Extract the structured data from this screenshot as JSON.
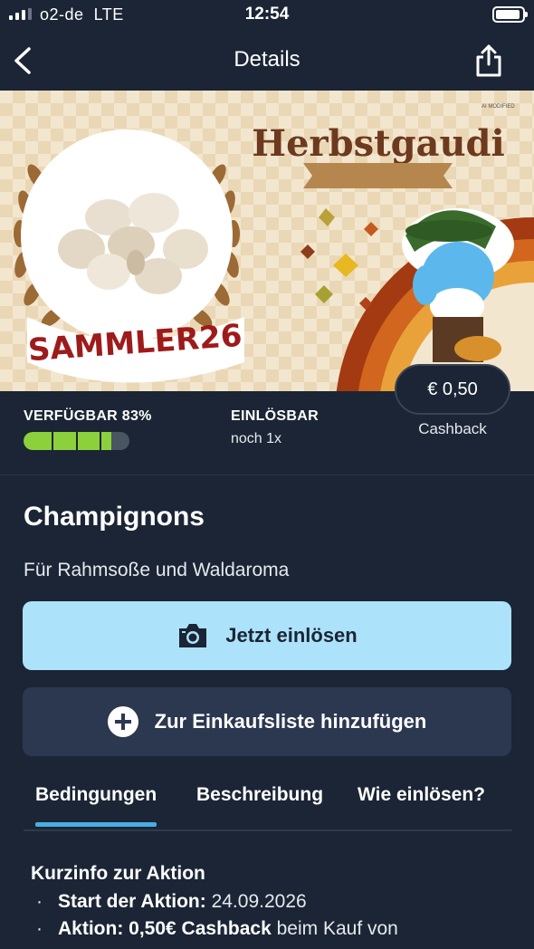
{
  "status_bar": {
    "carrier": "o2-de",
    "network": "LTE",
    "time": "12:54"
  },
  "nav": {
    "title": "Details"
  },
  "hero": {
    "headline": "Herbstgaudi",
    "badge": "SAMMLER26",
    "corner_label": "AI MODIFIED"
  },
  "stats": {
    "available_label": "VERFÜGBAR 83%",
    "available_fraction": 0.83,
    "redeemable_label": "EINLÖSBAR",
    "redeemable_value": "noch 1x",
    "price": "€ 0,50",
    "price_caption": "Cashback"
  },
  "product": {
    "title": "Champignons",
    "subtitle": "Für Rahmsoße und Waldaroma"
  },
  "actions": {
    "redeem_label": "Jetzt einlösen",
    "add_list_label": "Zur Einkaufsliste hinzufügen"
  },
  "tabs": [
    "Bedingungen",
    "Beschreibung",
    "Wie einlösen?"
  ],
  "conditions": {
    "heading": "Kurzinfo zur Aktion",
    "items": [
      {
        "bold": "Start der Aktion:",
        "text": " 24.09.2026"
      },
      {
        "bold": "Aktion: 0,50€ Cashback",
        "text": " beim Kauf von"
      }
    ]
  },
  "colors": {
    "background": "#1b2535",
    "primary_button": "#ace3fb",
    "secondary_button": "#2c3850",
    "progress": "#8cd13c",
    "tab_indicator": "#49aee2"
  }
}
